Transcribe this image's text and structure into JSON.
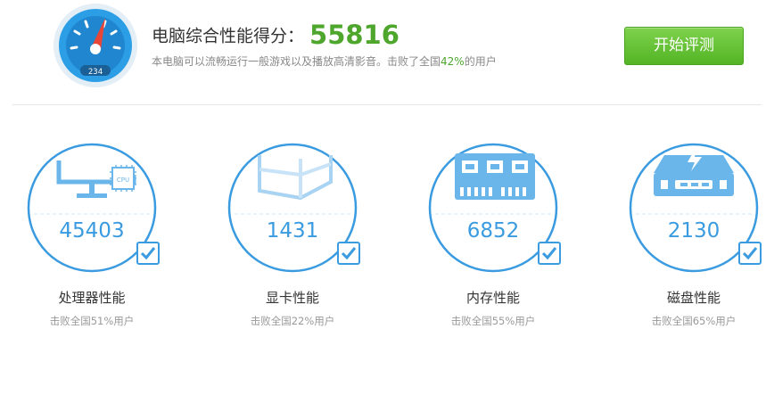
{
  "header": {
    "gauge_readout": "234",
    "title_label": "电脑综合性能得分：",
    "score": "55816",
    "subtitle_prefix": "本电脑可以流畅运行一般游戏以及播放高清影音。击败了全国",
    "subtitle_percent": "42%",
    "subtitle_suffix": "的用户",
    "start_button": "开始评测"
  },
  "cards": [
    {
      "icon": "cpu-monitor-icon",
      "badge": "CPU",
      "value": "45403",
      "title": "处理器性能",
      "desc": "击败全国51%用户"
    },
    {
      "icon": "graphics-card-icon",
      "value": "1431",
      "title": "显卡性能",
      "desc": "击败全国22%用户"
    },
    {
      "icon": "memory-chip-icon",
      "value": "6852",
      "title": "内存性能",
      "desc": "击败全国55%用户"
    },
    {
      "icon": "hard-disk-icon",
      "value": "2130",
      "title": "磁盘性能",
      "desc": "击败全国65%用户"
    }
  ],
  "colors": {
    "accent": "#3a9be0",
    "score": "#4ea62d",
    "button": "#53b424"
  }
}
